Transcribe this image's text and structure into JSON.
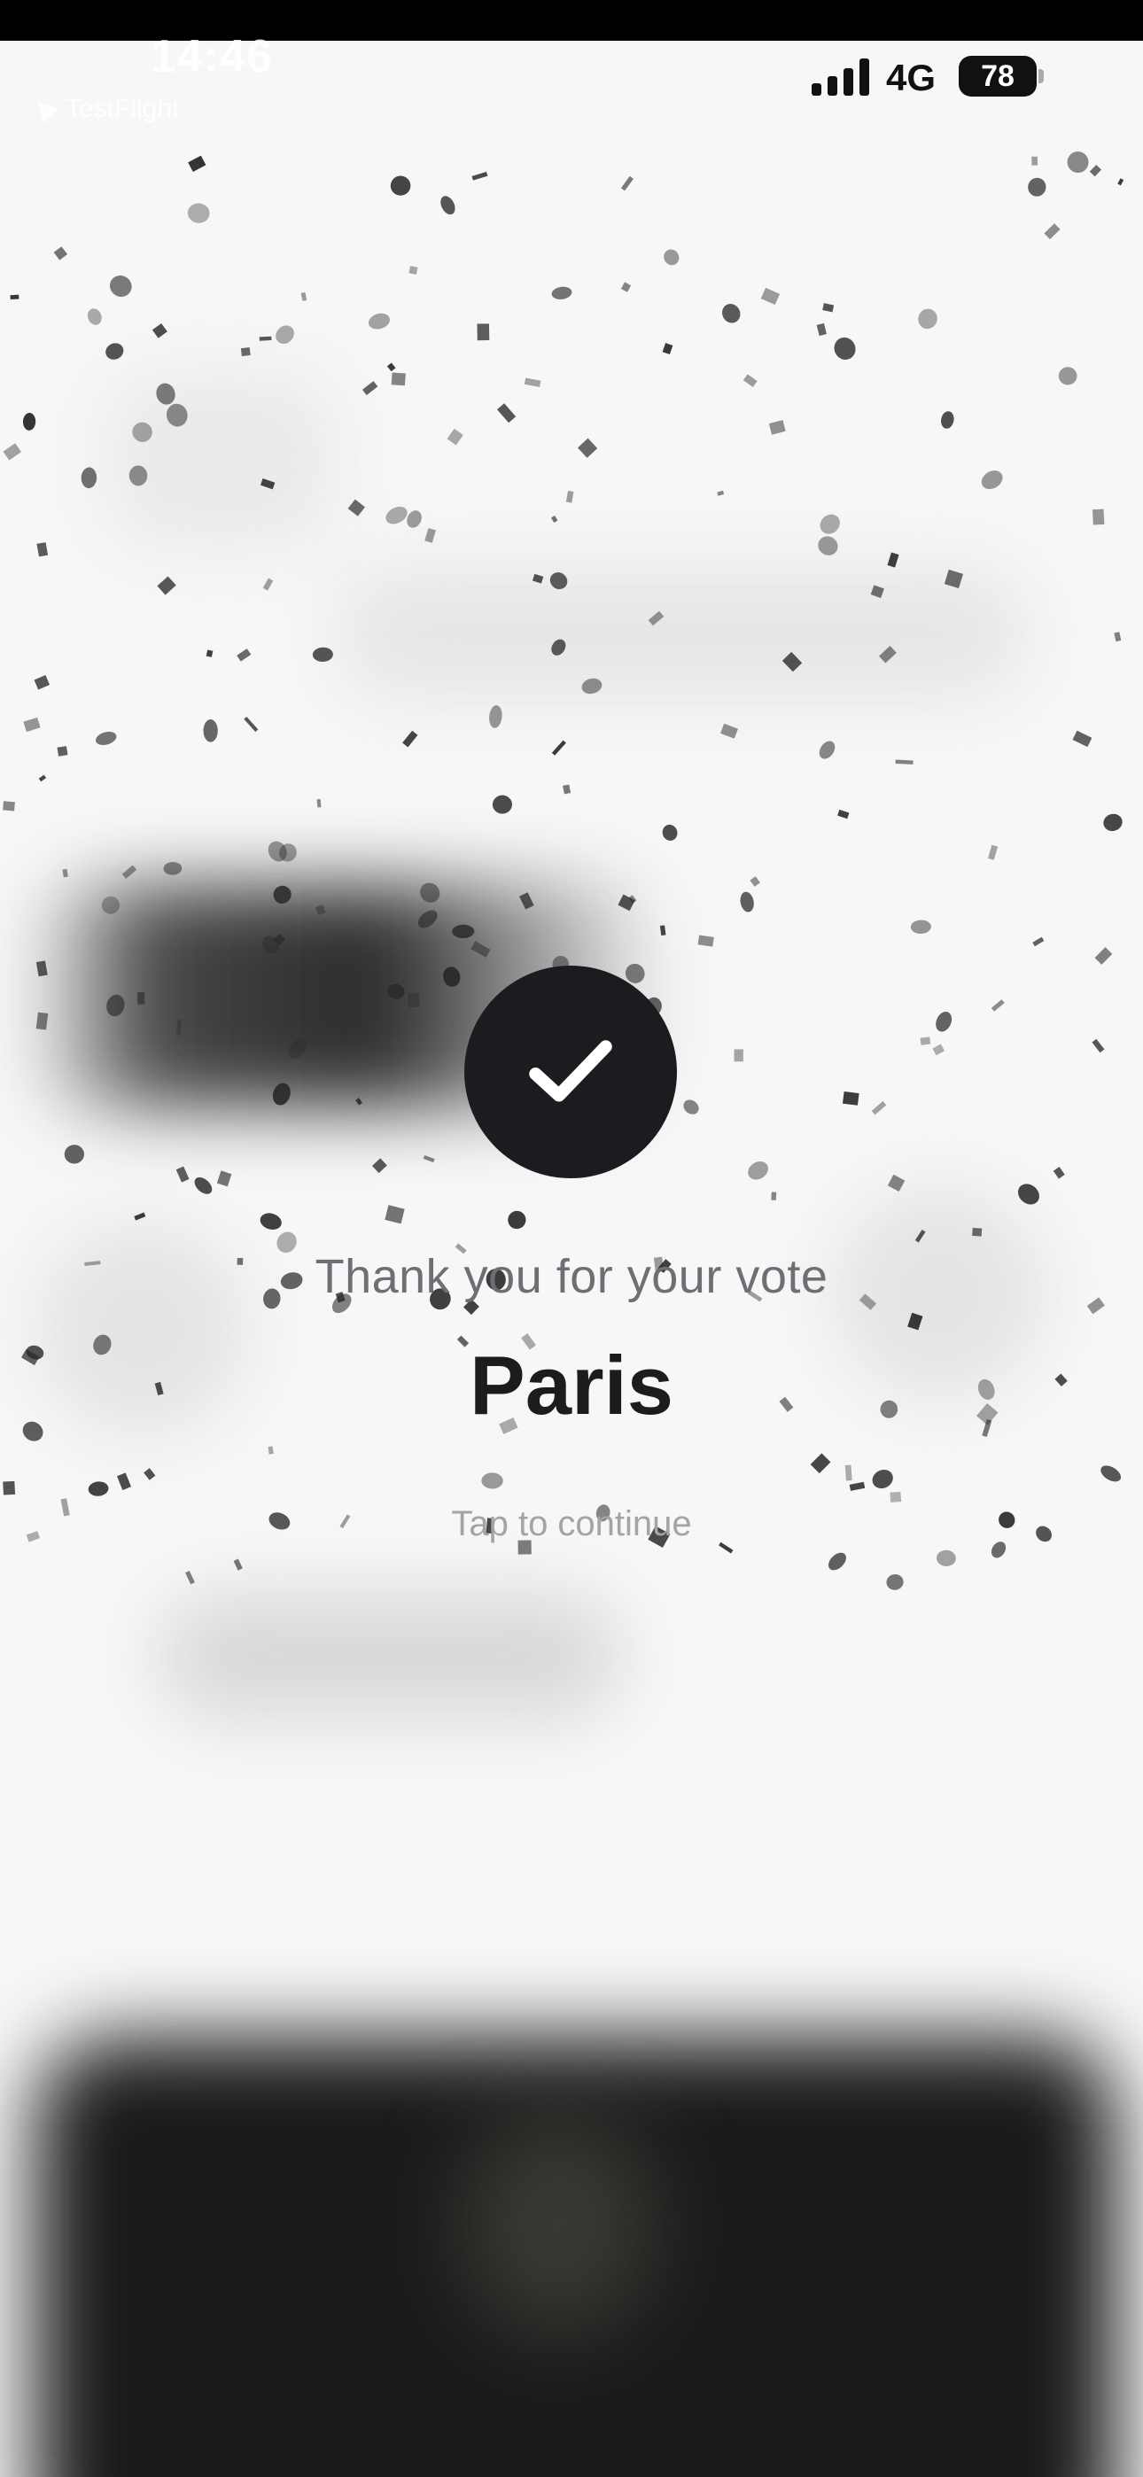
{
  "status_bar": {
    "time": "14:46",
    "testflight_label": "TestFlight",
    "network": "4G",
    "battery": "78"
  },
  "result": {
    "message": "Thank you for your vote",
    "choice": "Paris",
    "hint": "Tap to continue"
  },
  "icons": {
    "check": "checkmark-icon",
    "signal": "cellular-signal-icon",
    "battery": "battery-icon",
    "back": "testflight-back-icon"
  },
  "colors": {
    "check_circle": "#1c1c20",
    "title_text": "#1c1c1e",
    "message_text": "#6e6e74",
    "hint_text": "#a3a3a8",
    "background": "#f7f7f7",
    "confetti": "#2a2a2a"
  }
}
